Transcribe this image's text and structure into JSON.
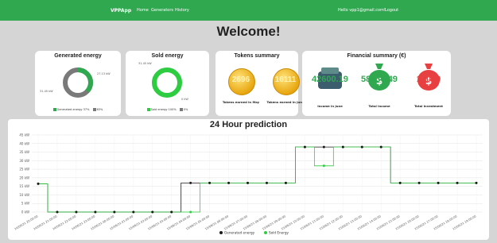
{
  "navbar": {
    "brand": "VPPApp",
    "links": [
      "Home",
      "Generators",
      "History"
    ],
    "hello": "Hello vpp1@gmail.com!",
    "logout": "Logout"
  },
  "welcome": "Welcome!",
  "generated": {
    "title": "Generated energy",
    "label_top": "27.13 kW",
    "label_left": "31.45 kW",
    "legend": [
      "Generated energy 37%",
      "63%"
    ],
    "percent": 37
  },
  "sold": {
    "title": "Sold energy",
    "label_top": "31.45 kW",
    "label_bottom": "0 kW",
    "legend": [
      "Sold energy 100%",
      "0%"
    ],
    "percent": 100
  },
  "tokens": {
    "title": "Tokens summary",
    "may_value": "2696",
    "may_caption": "Tokens earned in May",
    "june_value": "16111",
    "june_caption": "Tokens earned in June"
  },
  "financial": {
    "title": "Financial summary (€)",
    "items": [
      {
        "value": "42600.19",
        "caption": "Income in June",
        "color": "#2fa84f"
      },
      {
        "value": "58836.49",
        "caption": "Total income",
        "color": "#2fa84f"
      },
      {
        "value": "15000",
        "caption": "Total investment",
        "color": "#e84040"
      }
    ]
  },
  "chart_data": {
    "type": "line",
    "title": "24 Hour prediction",
    "ylim": [
      0,
      45
    ],
    "yticks": [
      "0 kW",
      "5 kW",
      "10 kW",
      "15 kW",
      "20 kW",
      "25 kW",
      "30 kW",
      "35 kW",
      "40 kW",
      "45 kW"
    ],
    "x": [
      "14/06/21 20:00:00",
      "14/06/21 21:00:00",
      "14/06/21 22:00:00",
      "14/06/21 23:00:00",
      "15/06/21 00:00:00",
      "15/06/21 01:00:00",
      "15/06/21 02:00:00",
      "15/06/21 03:00:00",
      "15/06/21 04:00:00",
      "15/06/21 05:00:00",
      "15/06/21 06:00:00",
      "15/06/21 07:00:00",
      "15/06/21 08:00:00",
      "15/06/21 09:00:00",
      "15/06/21 10:00:00",
      "15/06/21 11:00:00",
      "15/06/21 12:00:00",
      "15/06/21 13:00:00",
      "15/06/21 14:00:00",
      "15/06/21 15:00:00",
      "15/06/21 16:00:00",
      "15/06/21 17:00:00",
      "15/06/21 18:00:00",
      "15/06/21 19:00:00"
    ],
    "series": [
      {
        "name": "Generated energy",
        "color": "#1a1a1a",
        "values": [
          16.5,
          0,
          0,
          0,
          0,
          0,
          0,
          0,
          17,
          17,
          17,
          17,
          17,
          17,
          38,
          38,
          38,
          38,
          38,
          17,
          17,
          17,
          17,
          17
        ]
      },
      {
        "name": "Sold Energy",
        "color": "#2ecc40",
        "values": [
          16.5,
          0,
          0,
          0,
          0,
          0,
          0,
          0,
          0,
          17,
          17,
          17,
          17,
          17,
          38,
          27,
          38,
          38,
          38,
          17,
          17,
          17,
          17,
          17
        ]
      }
    ]
  }
}
